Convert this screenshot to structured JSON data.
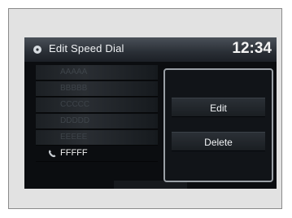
{
  "header": {
    "title": "Edit Speed Dial",
    "clock": "12:34",
    "icon": "disc-icon"
  },
  "speed_dial": {
    "items": [
      {
        "label": "AAAAA",
        "selected": false
      },
      {
        "label": "BBBBB",
        "selected": false
      },
      {
        "label": "CCCCC",
        "selected": false
      },
      {
        "label": "DDDDD",
        "selected": false
      },
      {
        "label": "EEEEE",
        "selected": false
      },
      {
        "label": "FFFFF",
        "selected": true,
        "icon": "phone-icon"
      }
    ]
  },
  "popup_menu": {
    "options": [
      {
        "label": "Edit"
      },
      {
        "label": "Delete"
      }
    ]
  },
  "colors": {
    "screen_bg": "#0b0d10",
    "text": "#f2f2f2",
    "dim_text": "#3e444a",
    "popup_border": "#9aa0a6"
  }
}
